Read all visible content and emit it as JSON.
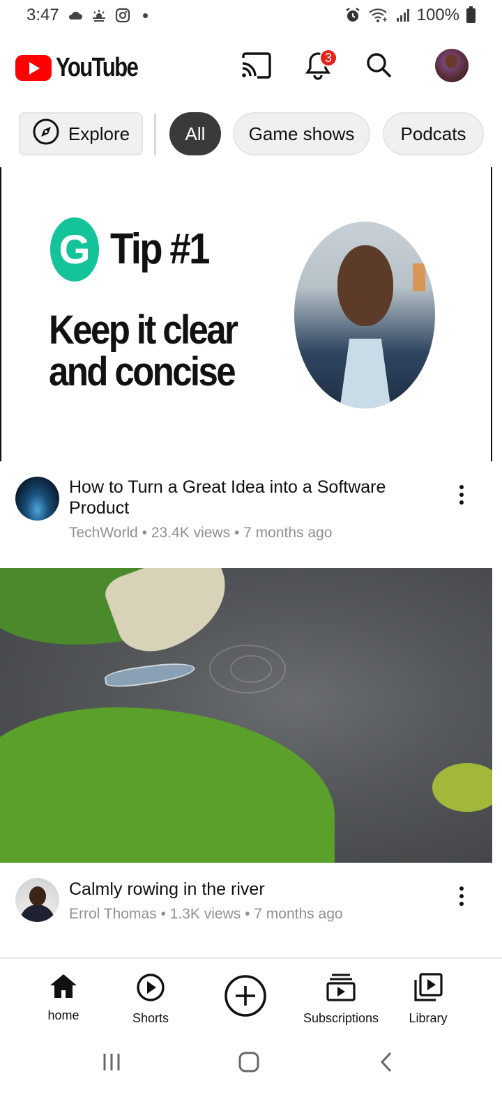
{
  "status_bar": {
    "time": "3:47",
    "battery": "100%",
    "left_icons": [
      "cloud-icon",
      "weather-icon",
      "instagram-icon",
      "dot-icon"
    ],
    "right_icons": [
      "alarm-icon",
      "wifi-icon",
      "signal-icon",
      "battery-icon"
    ]
  },
  "header": {
    "logo_text": "YouTube",
    "notification_count": "3",
    "icons": [
      "cast-icon",
      "bell-icon",
      "search-icon",
      "avatar"
    ]
  },
  "chips": {
    "explore": "Explore",
    "items": [
      "All",
      "Game shows",
      "Podcats"
    ],
    "selected": "All"
  },
  "videos": [
    {
      "thumbnail_text": {
        "brand_letter": "G",
        "tip": "Tip #1",
        "line1": "Keep it clear",
        "line2": "and concise"
      },
      "title": "How to Turn a Great Idea into a Software Product",
      "channel": "TechWorld",
      "views": "23.4K views",
      "age": "7 months ago",
      "separator": "•"
    },
    {
      "title": "Calmly rowing in the river",
      "channel": "Errol Thomas",
      "views": "1.3K views",
      "age": "7 months ago",
      "separator": "•"
    }
  ],
  "bottom_nav": {
    "home": "home",
    "shorts": "Shorts",
    "subscriptions": "Subscriptions",
    "library": "Library"
  },
  "colors": {
    "brand_red": "#ff0000",
    "badge_red": "#e62117",
    "chip_active": "#3a3a3a",
    "meta_grey": "#909090",
    "grammarly_green": "#15c39a"
  }
}
